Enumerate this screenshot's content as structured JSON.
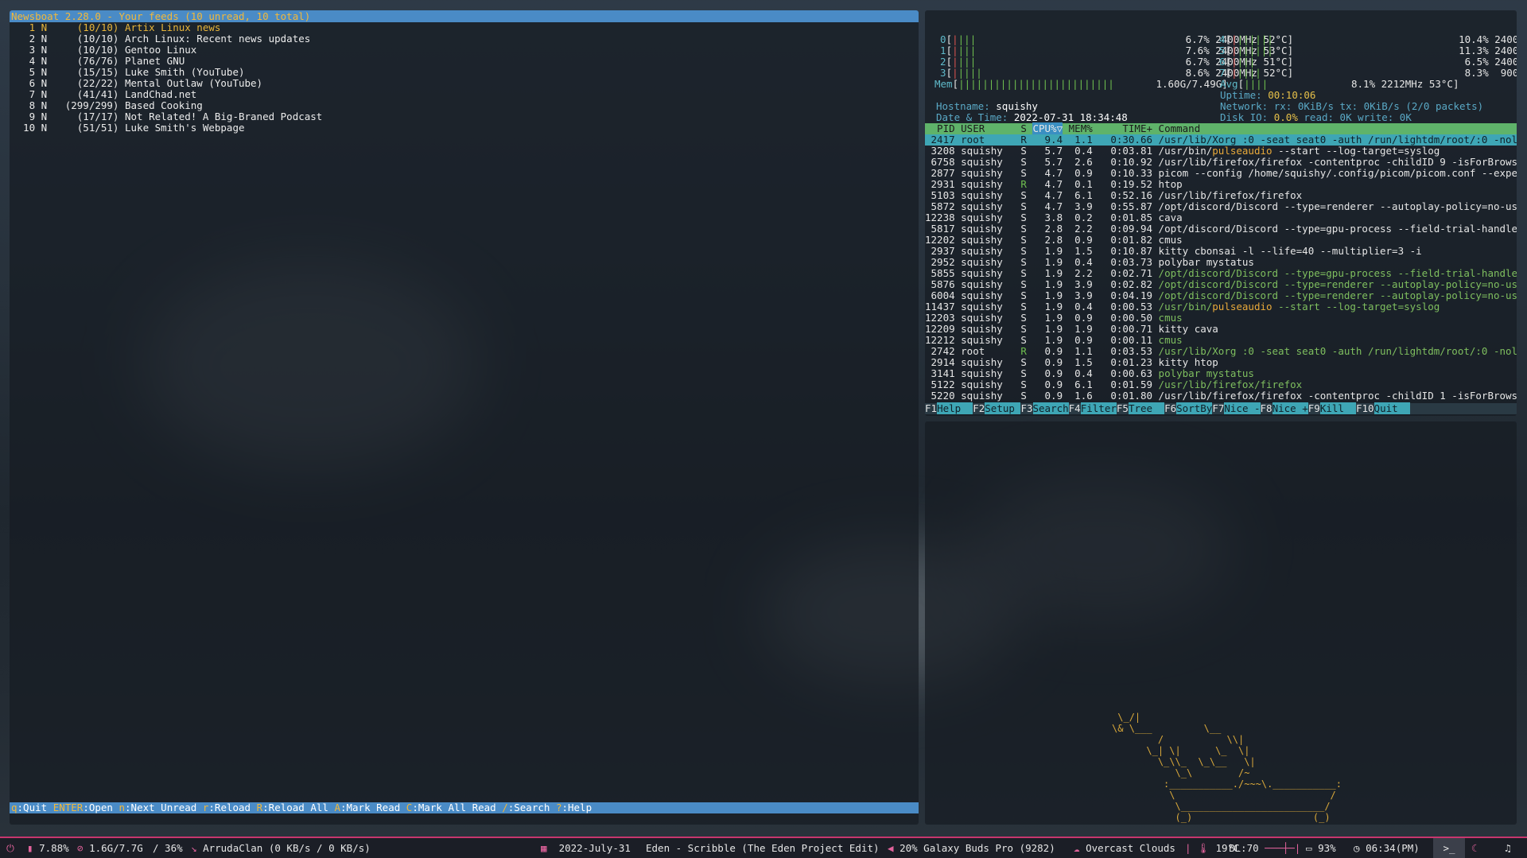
{
  "newsboat": {
    "title": "Newsboat 2.28.0 - Your feeds (10 unread, 10 total)",
    "feeds": [
      {
        "num": "1",
        "flag": "N",
        "count": "(10/10)",
        "name": "Artix Linux news"
      },
      {
        "num": "2",
        "flag": "N",
        "count": "(10/10)",
        "name": "Arch Linux: Recent news updates"
      },
      {
        "num": "3",
        "flag": "N",
        "count": "(10/10)",
        "name": "Gentoo Linux"
      },
      {
        "num": "4",
        "flag": "N",
        "count": "(76/76)",
        "name": "Planet GNU"
      },
      {
        "num": "5",
        "flag": "N",
        "count": "(15/15)",
        "name": "Luke Smith (YouTube)"
      },
      {
        "num": "6",
        "flag": "N",
        "count": "(22/22)",
        "name": "Mental Outlaw (YouTube)"
      },
      {
        "num": "7",
        "flag": "N",
        "count": "(41/41)",
        "name": "LandChad.net"
      },
      {
        "num": "8",
        "flag": "N",
        "count": "(299/299)",
        "name": "Based Cooking"
      },
      {
        "num": "9",
        "flag": "N",
        "count": "(17/17)",
        "name": "Not Related! A Big-Braned Podcast"
      },
      {
        "num": "10",
        "flag": "N",
        "count": "(51/51)",
        "name": "Luke Smith's Webpage"
      }
    ],
    "footer": [
      {
        "key": "q",
        "label": ":Quit "
      },
      {
        "key": "ENTER",
        "label": ":Open "
      },
      {
        "key": "n",
        "label": ":Next Unread "
      },
      {
        "key": "r",
        "label": ":Reload "
      },
      {
        "key": "R",
        "label": ":Reload All "
      },
      {
        "key": "A",
        "label": ":Mark Read "
      },
      {
        "key": "C",
        "label": ":Mark All Read "
      },
      {
        "key": "/",
        "label": ":Search "
      },
      {
        "key": "?",
        "label": ":Help"
      }
    ]
  },
  "htop": {
    "cpus_left": [
      {
        "id": "0",
        "bar": "||||",
        "pct": "6.7%",
        "freq": "2400MHz",
        "temp": "52°C"
      },
      {
        "id": "1",
        "bar": "||||",
        "pct": "7.6%",
        "freq": "2400MHz",
        "temp": "53°C"
      },
      {
        "id": "2",
        "bar": "||||",
        "pct": "6.7%",
        "freq": "2400MHz",
        "temp": "51°C"
      },
      {
        "id": "3",
        "bar": "|||||",
        "pct": "8.6%",
        "freq": "2400MHz",
        "temp": "52°C"
      }
    ],
    "cpus_right": [
      {
        "id": "4",
        "bar": "|||||||",
        "pct": "10.4%",
        "freq": "2400MHz",
        "temp": "52°C"
      },
      {
        "id": "5",
        "bar": "|||||||",
        "pct": "11.3%",
        "freq": "2400MHz",
        "temp": "53°C"
      },
      {
        "id": "6",
        "bar": "||||",
        "pct": "6.5%",
        "freq": "2400MHz",
        "temp": "51°C"
      },
      {
        "id": "7",
        "bar": "|||||",
        "pct": "8.3%",
        "freq": " 900MHz",
        "temp": "52°C"
      }
    ],
    "mem": {
      "label": "Mem",
      "bar": "||||||||||||||||||||||||||",
      "value": "1.60G/7.49G"
    },
    "avg": {
      "label": "Avg",
      "bar": "||||",
      "pct": "8.1%",
      "freq": "2212MHz",
      "temp": "53°C"
    },
    "uptime_label": "Uptime:",
    "uptime": "00:10:06",
    "hostname_label": "Hostname:",
    "hostname": "squishy",
    "network_label": "Network:",
    "network": "rx: 0KiB/s tx: 0KiB/s (2/0 packets)",
    "datetime_label": "Date & Time:",
    "datetime": "2022-07-31 18:34:48",
    "disk_label": "Disk IO:",
    "disk_pct": "0.0%",
    "disk_rest": "read: 0K write: 0K",
    "columns": {
      "pid": "PID",
      "user": "USER",
      "s": "S",
      "cpu": "CPU%▽",
      "mem": "MEM%",
      "time": "TIME+",
      "cmd": "Command"
    },
    "processes": [
      {
        "pid": "2417",
        "user": "root",
        "s": "R",
        "cpu": "9.4",
        "mem": "1.1",
        "time": "0:30.66",
        "cmd": "/usr/lib/Xorg :0 -seat seat0 -auth /run/lightdm/root/:0 -nolisten t",
        "sel": true
      },
      {
        "pid": "3208",
        "user": "squishy",
        "s": "S",
        "cpu": "5.7",
        "mem": "0.4",
        "time": "0:03.81",
        "cmd_pre": "/usr/bin/",
        "cmd_hl": "pulseaudio",
        "cmd": " --start --log-target=syslog"
      },
      {
        "pid": "6758",
        "user": "squishy",
        "s": "S",
        "cpu": "5.7",
        "mem": "2.6",
        "time": "0:10.92",
        "cmd": "/usr/lib/firefox/firefox -contentproc -childID 9 -isForBrowser -pre"
      },
      {
        "pid": "2877",
        "user": "squishy",
        "s": "S",
        "cpu": "4.7",
        "mem": "0.9",
        "time": "0:10.33",
        "cmd": "picom --config /home/squishy/.config/picom/picom.conf --experimenta"
      },
      {
        "pid": "2931",
        "user": "squishy",
        "s": "R",
        "cpu": "4.7",
        "mem": "0.1",
        "time": "0:19.52",
        "cmd": "htop"
      },
      {
        "pid": "5103",
        "user": "squishy",
        "s": "S",
        "cpu": "4.7",
        "mem": "6.1",
        "time": "0:52.16",
        "cmd": "/usr/lib/firefox/firefox"
      },
      {
        "pid": "5872",
        "user": "squishy",
        "s": "S",
        "cpu": "4.7",
        "mem": "3.9",
        "time": "0:55.87",
        "cmd": "/opt/discord/Discord --type=renderer --autoplay-policy=no-user-gest"
      },
      {
        "pid": "12238",
        "user": "squishy",
        "s": "S",
        "cpu": "3.8",
        "mem": "0.2",
        "time": "0:01.85",
        "cmd": "cava"
      },
      {
        "pid": "5817",
        "user": "squishy",
        "s": "S",
        "cpu": "2.8",
        "mem": "2.2",
        "time": "0:09.94",
        "cmd": "/opt/discord/Discord --type=gpu-process --field-trial-handle=130328"
      },
      {
        "pid": "12202",
        "user": "squishy",
        "s": "S",
        "cpu": "2.8",
        "mem": "0.9",
        "time": "0:01.82",
        "cmd": "cmus"
      },
      {
        "pid": "2937",
        "user": "squishy",
        "s": "S",
        "cpu": "1.9",
        "mem": "1.5",
        "time": "0:10.87",
        "cmd": "kitty cbonsai -l --life=40 --multiplier=3 -i"
      },
      {
        "pid": "2952",
        "user": "squishy",
        "s": "S",
        "cpu": "1.9",
        "mem": "0.4",
        "time": "0:03.73",
        "cmd": "polybar mystatus"
      },
      {
        "pid": "5855",
        "user": "squishy",
        "s": "S",
        "cpu": "1.9",
        "mem": "2.2",
        "time": "0:02.71",
        "cmd": "/opt/discord/Discord --type=gpu-process --field-trial-handle=130328",
        "thread": true
      },
      {
        "pid": "5876",
        "user": "squishy",
        "s": "S",
        "cpu": "1.9",
        "mem": "3.9",
        "time": "0:02.82",
        "cmd": "/opt/discord/Discord --type=renderer --autoplay-policy=no-user-gest",
        "thread": true
      },
      {
        "pid": "6004",
        "user": "squishy",
        "s": "S",
        "cpu": "1.9",
        "mem": "3.9",
        "time": "0:04.19",
        "cmd": "/opt/discord/Discord --type=renderer --autoplay-policy=no-user-gest",
        "thread": true
      },
      {
        "pid": "11437",
        "user": "squishy",
        "s": "S",
        "cpu": "1.9",
        "mem": "0.4",
        "time": "0:00.53",
        "cmd_pre": "/usr/bin/",
        "cmd_hl": "pulseaudio",
        "cmd": " --start --log-target=syslog",
        "thread": true
      },
      {
        "pid": "12203",
        "user": "squishy",
        "s": "S",
        "cpu": "1.9",
        "mem": "0.9",
        "time": "0:00.50",
        "cmd": "cmus",
        "thread": true
      },
      {
        "pid": "12209",
        "user": "squishy",
        "s": "S",
        "cpu": "1.9",
        "mem": "1.9",
        "time": "0:00.71",
        "cmd": "kitty cava"
      },
      {
        "pid": "12212",
        "user": "squishy",
        "s": "S",
        "cpu": "1.9",
        "mem": "0.9",
        "time": "0:00.11",
        "cmd": "cmus",
        "thread": true
      },
      {
        "pid": "2742",
        "user": "root",
        "s": "R",
        "cpu": "0.9",
        "mem": "1.1",
        "time": "0:03.53",
        "cmd": "/usr/lib/Xorg :0 -seat seat0 -auth /run/lightdm/root/:0 -nolisten t",
        "thread": true
      },
      {
        "pid": "2914",
        "user": "squishy",
        "s": "S",
        "cpu": "0.9",
        "mem": "1.5",
        "time": "0:01.23",
        "cmd": "kitty htop"
      },
      {
        "pid": "3141",
        "user": "squishy",
        "s": "S",
        "cpu": "0.9",
        "mem": "0.4",
        "time": "0:00.63",
        "cmd": "polybar mystatus",
        "thread": true
      },
      {
        "pid": "5122",
        "user": "squishy",
        "s": "S",
        "cpu": "0.9",
        "mem": "6.1",
        "time": "0:01.59",
        "cmd": "/usr/lib/firefox/firefox",
        "thread": true
      },
      {
        "pid": "5220",
        "user": "squishy",
        "s": "S",
        "cpu": "0.9",
        "mem": "1.6",
        "time": "0:01.80",
        "cmd": "/usr/lib/firefox/firefox -contentproc -childID 1 -isForBrowser -pre"
      }
    ],
    "fkeys": [
      {
        "n": "F1",
        "l": "Help  "
      },
      {
        "n": "F2",
        "l": "Setup "
      },
      {
        "n": "F3",
        "l": "Search"
      },
      {
        "n": "F4",
        "l": "Filter"
      },
      {
        "n": "F5",
        "l": "Tree  "
      },
      {
        "n": "F6",
        "l": "SortBy"
      },
      {
        "n": "F7",
        "l": "Nice -"
      },
      {
        "n": "F8",
        "l": "Nice +"
      },
      {
        "n": "F9",
        "l": "Kill  "
      },
      {
        "n": "F10",
        "l": "Quit  "
      }
    ]
  },
  "polybar": {
    "cpu": "7.88%",
    "mem": "1.6G/7.7G",
    "disk": "/ 36%",
    "network": "ArrudaClan (0 KB/s / 0 KB/s)",
    "date": "2022-July-31",
    "song": "Eden - Scribble (The Eden Project Edit)",
    "volume": "20% Galaxy Buds Pro (9282)",
    "weather": "Overcast Clouds",
    "temp": "19°C",
    "backlight": "BL:70",
    "battery": "93%",
    "time": "06:34(PM)",
    "icons": {
      "power": "power-icon",
      "cpu": "cpu-icon",
      "mem": "memory-icon",
      "net": "wifi-icon",
      "date": "calendar-icon",
      "vol": "volume-icon",
      "weather": "cloud-icon",
      "temp": "thermometer-icon",
      "battery": "battery-icon",
      "time": "clock-icon",
      "term": "terminal-icon",
      "moon": "moon-icon",
      "headphones": "headphones-icon"
    }
  },
  "colors": {
    "accent_blue": "#4a8bc6",
    "htop_header": "#5fb36a",
    "htop_select": "#3ea6b5",
    "polybar_border": "#c8366e",
    "feed_selected": "#e8b53a"
  }
}
